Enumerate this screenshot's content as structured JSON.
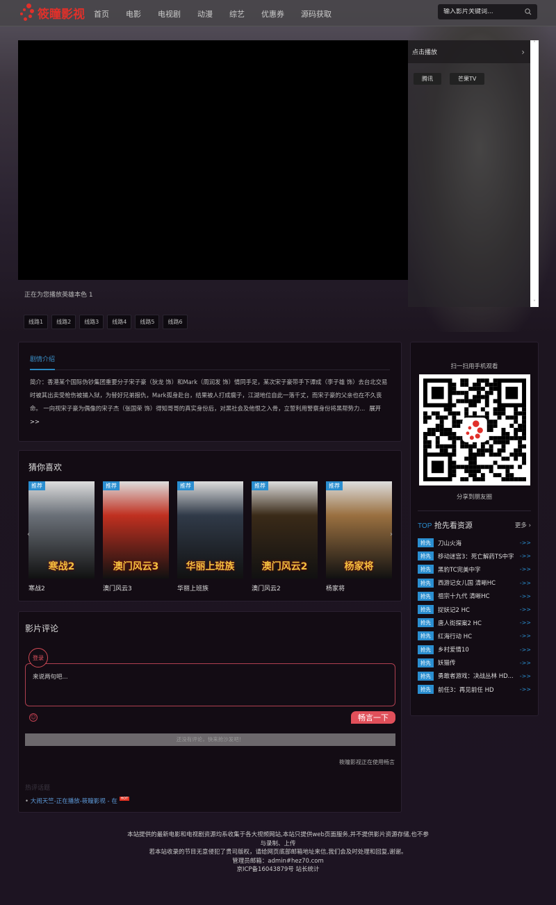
{
  "header": {
    "logo": "筱瞳影视",
    "nav": [
      "首页",
      "电影",
      "电视剧",
      "动漫",
      "综艺",
      "优惠券",
      "源码获取"
    ],
    "search_placeholder": "输入影片关键词..."
  },
  "player": {
    "panel_title": "点击播放",
    "sources": [
      "腾讯",
      "芒果TV"
    ],
    "status": "正在为您播放英雄本色 1",
    "lines": [
      "线路1",
      "线路2",
      "线路3",
      "线路4",
      "线路5",
      "线路6"
    ]
  },
  "plot": {
    "tab": "剧情介绍",
    "text": "简介：香港某个国际伪钞集团重要分子宋子豪（狄龙 饰）和Mark（周润发 饰）情同手足，某次宋子豪带手下谭成（李子雄 饰）去台北交易时被其出卖受枪伤被捕入狱，为替好兄弟报仇，Mark孤身赴台，结果被人打成瘸子，江湖地位自此一落千丈，而宋子豪的父亲也在不久丧命。 一向视宋子豪为偶像的宋子杰（张国荣 饰）得知哥哥的真实身份后，对黑社会及他恨之入骨，立誓利用警察身份将黑帮势力...",
    "more": "展开>>"
  },
  "guess": {
    "title": "猜你喜欢",
    "badge": "推荐",
    "items": [
      {
        "title": "寒战2",
        "color": "#6a7078"
      },
      {
        "title": "澳门风云3",
        "color": "#c03020"
      },
      {
        "title": "华丽上班族",
        "color": "#303a48"
      },
      {
        "title": "澳门风云2",
        "color": "#3a2a18"
      },
      {
        "title": "杨家将",
        "color": "#9a7040"
      }
    ]
  },
  "comments": {
    "title": "影片评论",
    "login": "登录",
    "placeholder": "来说两句吧...",
    "send": "畅言一下",
    "empty": "还没有评论，快来抢沙发吧！",
    "using": "筱瞳影视正在使用畅言",
    "hot_title": "热评话题",
    "hot_item": "大闹天竺-正在播放-筱瞳影视 - 在",
    "hot_badge": "HOT"
  },
  "sidebar": {
    "qr_title": "扫一扫用手机观看",
    "qr_share": "分享到朋友圈",
    "top_prefix": "TOP",
    "top_title": "抢先看资源",
    "more": "更多",
    "badge": "抢先",
    "go": "->>",
    "items": [
      "刀山火海",
      "移动迷宫3：死亡解药TS中字",
      "黑豹TC完美中字",
      "西游记女儿国 清晰HC",
      "祖宗十九代 清晰HC",
      "捉妖记2 HC",
      "唐人街探案2 HC",
      "红海行动 HC",
      "乡村爱情10",
      "妖猫传",
      "勇敢者游戏：决战丛林 HD...",
      "前任3：再见前任 HD"
    ]
  },
  "footer": {
    "line1": "本站提供的最新电影和电视剧资源均系收集于各大视频网站,本站只提供web页面服务,并不提供影片资源存储,也不参与录制、上传",
    "line2": "若本站收录的节目无意侵犯了贵司版权，请给网页底部邮箱地址来信,我们会及时处理和回复,谢谢。",
    "line3": "管理员邮箱：admin#hez70.com",
    "line4": "京ICP备16043879号 站长统计"
  },
  "colors": {
    "accent": "#2a8ed0",
    "brand": "#e0302a",
    "send": "#e0505a"
  }
}
